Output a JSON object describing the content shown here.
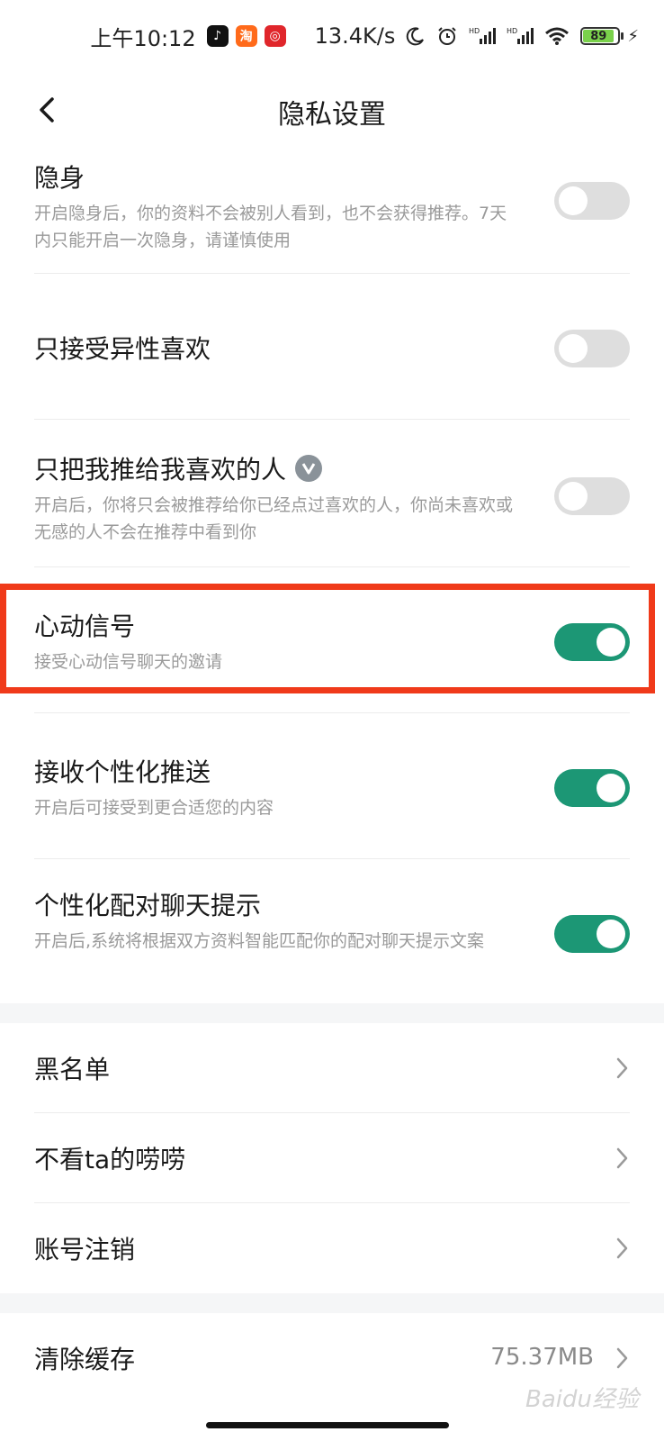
{
  "status_bar": {
    "time": "上午10:12",
    "speed": "13.4K/s",
    "battery": "89",
    "battery_level": 0.89,
    "app_icons": [
      "tiktok-icon",
      "taobao-icon",
      "netease-music-icon"
    ],
    "colors": {
      "tiktok": "#111111",
      "taobao": "#ff6a1a",
      "netease": "#e0262b"
    }
  },
  "nav": {
    "title": "隐私设置"
  },
  "settings": [
    {
      "id": "invisible",
      "title": "隐身",
      "desc": "开启隐身后，你的资料不会被别人看到，也不会获得推荐。7天内只能开启一次隐身，请谨慎使用",
      "on": false
    },
    {
      "id": "opposite-gender",
      "title": "只接受异性喜欢",
      "desc": "",
      "on": false
    },
    {
      "id": "push-to-liked",
      "title": "只把我推给我喜欢的人",
      "desc": "开启后，你将只会被推荐给你已经点过喜欢的人，你尚未喜欢或无感的人不会在推荐中看到你",
      "on": false,
      "badge": "vip-icon"
    },
    {
      "id": "heartbeat-signal",
      "title": "心动信号",
      "desc": "接受心动信号聊天的邀请",
      "on": true
    },
    {
      "id": "personalized-push",
      "title": "接收个性化推送",
      "desc": "开启后可接受到更合适您的内容",
      "on": true
    },
    {
      "id": "match-chat-tips",
      "title": "个性化配对聊天提示",
      "desc": "开启后,系统将根据双方资料智能匹配你的配对聊天提示文案",
      "on": true
    }
  ],
  "links": [
    {
      "title": "黑名单"
    },
    {
      "title": "不看ta的唠唠"
    },
    {
      "title": "账号注销"
    }
  ],
  "cache": {
    "title": "清除缓存",
    "size": "75.37MB"
  },
  "watermark": "Baidu经验",
  "colors": {
    "toggle_on": "#1c9775",
    "toggle_off": "#dedede",
    "highlight": "#f03a1a"
  }
}
